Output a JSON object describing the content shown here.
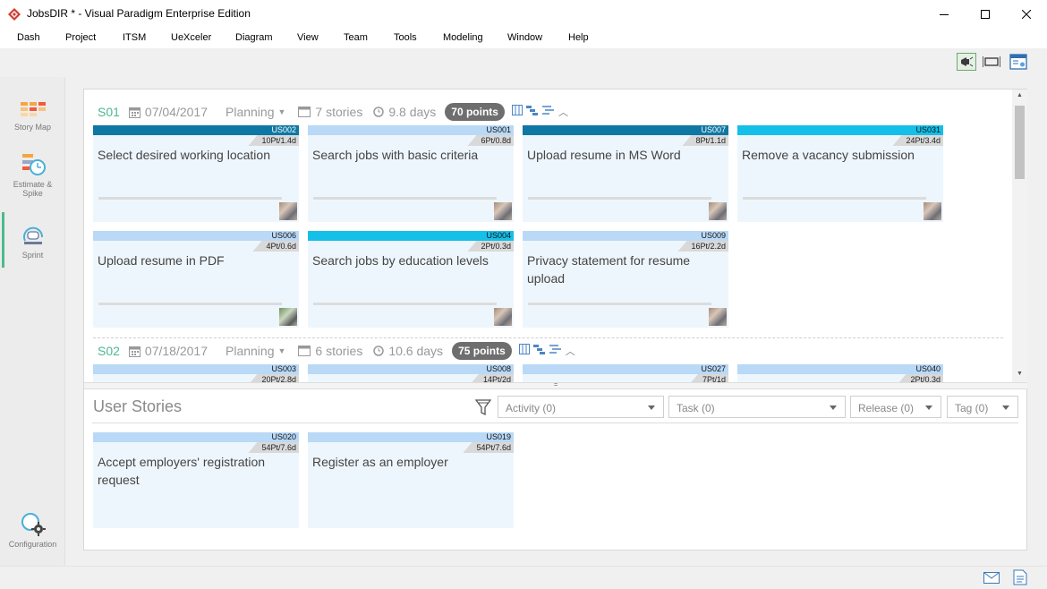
{
  "window": {
    "title": "JobsDIR * - Visual Paradigm Enterprise Edition",
    "controls": {
      "minimize": "─",
      "maximize": "☐",
      "close": "✕"
    }
  },
  "menu": [
    "Dash",
    "Project",
    "ITSM",
    "UeXceler",
    "Diagram",
    "View",
    "Team",
    "Tools",
    "Modeling",
    "Window",
    "Help"
  ],
  "toolbar": {
    "icons": [
      "announcement-icon",
      "fit-width-icon",
      "layout-icon"
    ]
  },
  "leftnav": {
    "story_map": "Story Map",
    "estimate_line1": "Estimate &",
    "estimate_line2": "Spike",
    "sprint": "Sprint",
    "configuration": "Configuration",
    "active": "Sprint"
  },
  "sprints": [
    {
      "name": "S01",
      "date": "07/04/2017",
      "status": "Planning",
      "stories": "7 stories",
      "duration": "9.8 days",
      "points": "70 points",
      "cards": [
        {
          "id": "US002",
          "est": "10Pt/1.4d",
          "title": "Select desired working location",
          "bar": "#0e77a4",
          "idcolor": "#ffffff",
          "avatar": "normal"
        },
        {
          "id": "US001",
          "est": "6Pt/0.8d",
          "title": "Search jobs with basic criteria",
          "bar": "#b9d9f7",
          "idcolor": "#111111",
          "avatar": "normal"
        },
        {
          "id": "US007",
          "est": "8Pt/1.1d",
          "title": "Upload resume in MS Word",
          "bar": "#0e77a4",
          "idcolor": "#ffffff",
          "avatar": "normal"
        },
        {
          "id": "US031",
          "est": "24Pt/3.4d",
          "title": "Remove a vacancy submission",
          "bar": "#14bfe8",
          "idcolor": "#111111",
          "avatar": "normal"
        },
        {
          "id": "US006",
          "est": "4Pt/0.6d",
          "title": "Upload resume in PDF",
          "bar": "#b9d9f7",
          "idcolor": "#111111",
          "avatar": "alt"
        },
        {
          "id": "US004",
          "est": "2Pt/0.3d",
          "title": "Search jobs by education levels",
          "bar": "#14bfe8",
          "idcolor": "#111111",
          "avatar": "normal"
        },
        {
          "id": "US009",
          "est": "16Pt/2.2d",
          "title": "Privacy statement for resume upload",
          "bar": "#b9d9f7",
          "idcolor": "#111111",
          "avatar": "normal"
        }
      ]
    },
    {
      "name": "S02",
      "date": "07/18/2017",
      "status": "Planning",
      "stories": "6 stories",
      "duration": "10.6 days",
      "points": "75 points",
      "cards": [
        {
          "id": "US003",
          "est": "20Pt/2.8d",
          "title": "",
          "bar": "#b9d9f7",
          "idcolor": "#111111"
        },
        {
          "id": "US008",
          "est": "14Pt/2d",
          "title": "",
          "bar": "#b9d9f7",
          "idcolor": "#111111"
        },
        {
          "id": "US027",
          "est": "7Pt/1d",
          "title": "",
          "bar": "#b9d9f7",
          "idcolor": "#111111"
        },
        {
          "id": "US040",
          "est": "2Pt/0.3d",
          "title": "",
          "bar": "#b9d9f7",
          "idcolor": "#111111"
        }
      ]
    }
  ],
  "user_stories": {
    "title": "User Stories",
    "filters": {
      "activity": "Activity (0)",
      "task": "Task (0)",
      "release": "Release (0)",
      "tag": "Tag (0)"
    },
    "cards": [
      {
        "id": "US020",
        "est": "54Pt/7.6d",
        "title": "Accept employers' registration request",
        "bar": "#b9d9f7",
        "idcolor": "#111111"
      },
      {
        "id": "US019",
        "est": "54Pt/7.6d",
        "title": "Register as an employer",
        "bar": "#b9d9f7",
        "idcolor": "#111111"
      }
    ]
  },
  "colors": {
    "accent_green": "#4db88f",
    "dark_blue": "#0e77a4",
    "cyan": "#14bfe8",
    "light_blue": "#b9d9f7",
    "card_bg": "#eef6fd"
  }
}
